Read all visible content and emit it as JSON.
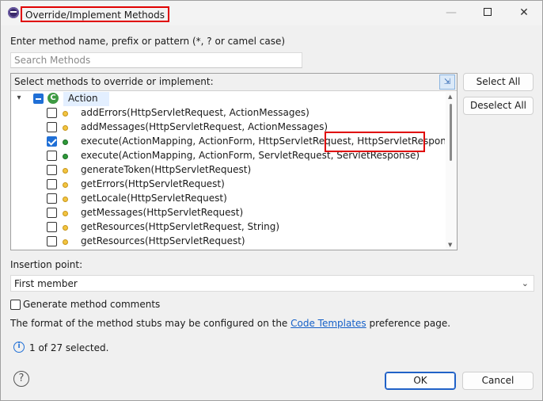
{
  "window": {
    "title": "Override/Implement Methods",
    "min_symbol": "—",
    "close_symbol": "✕"
  },
  "prompt_label": "Enter method name, prefix or pattern (*, ? or camel case)",
  "search": {
    "placeholder": "Search Methods",
    "value": ""
  },
  "list": {
    "header": "Select methods to override or implement:",
    "class_name": "Action",
    "expand_symbol": "▾",
    "class_glyph": "C",
    "sort_glyph": "⇲",
    "methods": [
      {
        "label": "addErrors(HttpServletRequest, ActionMessages)",
        "checked": false,
        "visibility": "protected"
      },
      {
        "label": "addMessages(HttpServletRequest, ActionMessages)",
        "checked": false,
        "visibility": "protected"
      },
      {
        "label": "execute(ActionMapping, ActionForm, HttpServletRequest, HttpServletResponse)",
        "checked": true,
        "visibility": "public"
      },
      {
        "label": "execute(ActionMapping, ActionForm, ServletRequest, ServletResponse)",
        "checked": false,
        "visibility": "public"
      },
      {
        "label": "generateToken(HttpServletRequest)",
        "checked": false,
        "visibility": "protected"
      },
      {
        "label": "getErrors(HttpServletRequest)",
        "checked": false,
        "visibility": "protected"
      },
      {
        "label": "getLocale(HttpServletRequest)",
        "checked": false,
        "visibility": "protected"
      },
      {
        "label": "getMessages(HttpServletRequest)",
        "checked": false,
        "visibility": "protected"
      },
      {
        "label": "getResources(HttpServletRequest, String)",
        "checked": false,
        "visibility": "protected"
      },
      {
        "label": "getResources(HttpServletRequest)",
        "checked": false,
        "visibility": "protected"
      }
    ]
  },
  "buttons": {
    "select_all": "Select All",
    "deselect_all": "Deselect All",
    "ok": "OK",
    "cancel": "Cancel"
  },
  "insertion": {
    "label": "Insertion point:",
    "value": "First member",
    "chevron": "⌄"
  },
  "generate_comments": {
    "label": "Generate method comments",
    "checked": false
  },
  "format_note": {
    "before": "The format of the method stubs may be configured on the ",
    "link": "Code Templates",
    "after": " preference page."
  },
  "status": {
    "text": "1 of 27 selected.",
    "icon": "i"
  },
  "help_icon": "?",
  "colors": {
    "highlight": "#e00000",
    "accent": "#1f6fd6",
    "protected_dot": "#f2c440",
    "public_dot": "#2e9a3a"
  }
}
